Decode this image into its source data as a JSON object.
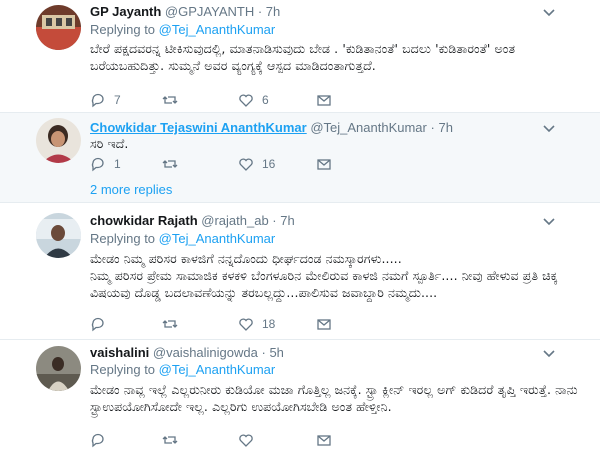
{
  "tweets": [
    {
      "name": "GP Jayanth",
      "handle": "@GPJAYANTH",
      "time": "7h",
      "replying_prefix": "Replying to",
      "replying_to": "@Tej_AnanthKumar",
      "text": "ಬೇರೆ ಪಕ್ಷದವರನ್ನ ಟೀಕಿಸುವುದಲ್ಲಿ, ಮಾತನಾಡಿಸುವುದು ಬೇಡ . 'ಕುಡಿತಾನಂತೆ' ಬದಲು 'ಕುಡಿತಾರಂತೆ' ಅಂತ ಬರೆಯಬಹುದಿತ್ತು. ಸುಮ್ಮನೆ ಅವರ ವ್ಯಂಗ್ಯಕ್ಕೆ ಆಸ್ಪದ ಮಾಡಿದಂತಾಗುತ್ತದೆ.",
      "replies": "7",
      "retweets": "",
      "likes": "6"
    },
    {
      "name": "Chowkidar Tejaswini AnanthKumar",
      "handle": "@Tej_AnanthKumar",
      "time": "7h",
      "text": "ಸರಿ ಇದೆ.",
      "replies": "1",
      "retweets": "",
      "likes": "16"
    },
    {
      "name": "chowkidar Rajath",
      "handle": "@rajath_ab",
      "time": "7h",
      "replying_prefix": "Replying to",
      "replying_to": "@Tej_AnanthKumar",
      "text": "ಮೇಡಂ ನಿಮ್ಮ ಪರಿಸರ ಕಾಳಜಿಗೆ ನನ್ನದೊಂದು ಧೀರ್ಘದಂಡ ನಮಸ್ಕಾರಗಳು.....\nನಿಮ್ಮ ಪರಿಸರ ಪ್ರೇಮ ಸಾಮಾಜಿಕ ಕಳಕಳಿ ಬೆಂಗಳೂರಿನ ಮೇಲಿರುವ ಕಾಳಜಿ ನಮಗೆ ಸ್ಪೂರ್ತಿ.... ನೀವು ಹೇಳುವ ಪ್ರತಿ ಚಿಕ್ಕ ವಿಷಯವು ದೊಡ್ಡ ಬದಲಾವಣೆಯನ್ನು ತರಬಲ್ಲದ್ದು...ಪಾಲಿಸುವ ಜವಾಬ್ದಾರಿ ನಮ್ಮದು....",
      "replies": "",
      "retweets": "",
      "likes": "18"
    },
    {
      "name": "vaishalini",
      "handle": "@vaishalinigowda",
      "time": "5h",
      "replying_prefix": "Replying to",
      "replying_to": "@Tej_AnanthKumar",
      "text": "ಮೇಡಂ ನಾವ್ಲ ಇಲ್ಲೆ ಎಲ್ಲರುನೀರು ಕುಡಿಯೋ ಮಜಾ ಗೊತ್ತಿಲ್ಲ ಜನಕ್ಕೆ. ಸ್ಟ್ರಾ ಕ್ಲೀನ್ ಇರಲ್ಲ ಅಗ್ ಕುಡಿದರೆ ತೃಪ್ತಿ ಇರುತ್ತೆ. ನಾನು ಸ್ಟ್ರಾಉಪಯೋಗಿಸೋದೇ ಇಲ್ಲ. ಎಲ್ಲರಿಗು ಉಪಯೋಗಿಸಬೇಡಿ ಅಂತ ಹೇಳ್ತೀನಿ.",
      "replies": "",
      "retweets": "",
      "likes": ""
    }
  ],
  "more_replies": "2 more replies",
  "dot": "·"
}
